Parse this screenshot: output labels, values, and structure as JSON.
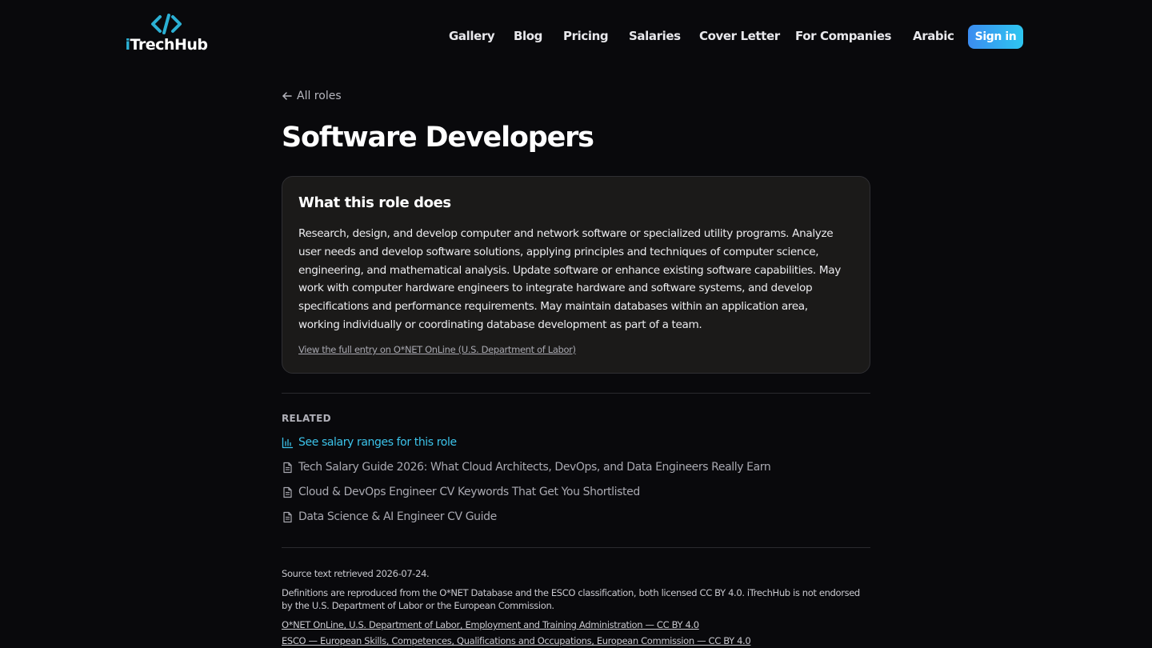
{
  "brand": {
    "name_prefix": "i",
    "name_rest": "TrechHub",
    "logo_icon": "code-brackets-icon",
    "accent_color": "#2bb0d4"
  },
  "nav": {
    "items": [
      "Gallery",
      "Blog",
      "Pricing",
      "Salaries",
      "Cover Letter",
      "For Companies",
      "Arabic"
    ],
    "signin_label": "Sign in"
  },
  "breadcrumb": {
    "back_label": "All roles",
    "icon": "arrow-left-icon"
  },
  "page_title": "Software Developers",
  "role_card": {
    "heading": "What this role does",
    "description": "Research, design, and develop computer and network software or specialized utility programs. Analyze user needs and develop software solutions, applying principles and techniques of computer science, engineering, and mathematical analysis. Update software or enhance existing software capabilities. May work with computer hardware engineers to integrate hardware and software systems, and develop specifications and performance requirements. May maintain databases within an application area, working individually or coordinating database development as part of a team.",
    "source_link": "View the full entry on O*NET OnLine (U.S. Department of Labor)"
  },
  "related": {
    "label": "RELATED",
    "items": [
      {
        "label": "See salary ranges for this role",
        "icon": "bar-chart-icon"
      },
      {
        "label": "Tech Salary Guide 2026: What Cloud Architects, DevOps, and Data Engineers Really Earn",
        "icon": "document-icon"
      },
      {
        "label": "Cloud & DevOps Engineer CV Keywords That Get You Shortlisted",
        "icon": "document-icon"
      },
      {
        "label": "Data Science & AI Engineer CV Guide",
        "icon": "document-icon"
      }
    ]
  },
  "footer": {
    "retrieved": "Source text retrieved 2026-07-24.",
    "license_note": "Definitions are reproduced from the O*NET Database and the ESCO classification, both licensed CC BY 4.0. iTrechHub is not endorsed by the U.S. Department of Labor or the European Commission.",
    "links": [
      "O*NET OnLine, U.S. Department of Labor, Employment and Training Administration — CC BY 4.0",
      "ESCO — European Skills, Competences, Qualifications and Occupations, European Commission — CC BY 4.0"
    ]
  }
}
